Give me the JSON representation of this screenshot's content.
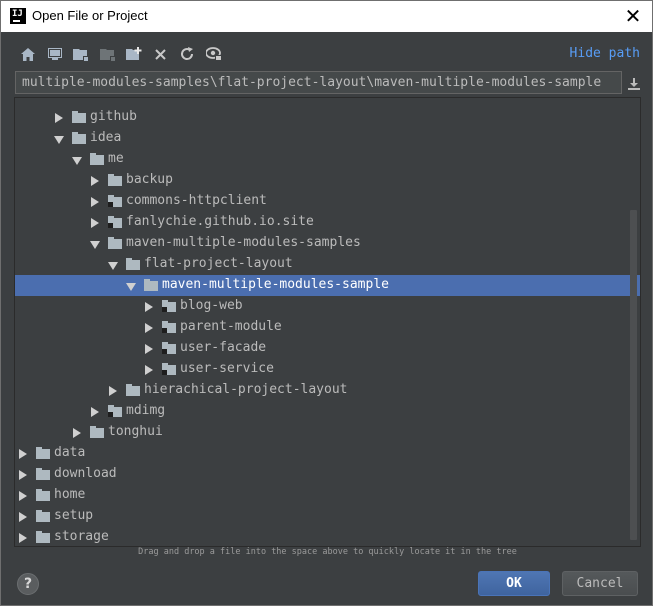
{
  "window": {
    "title": "Open File or Project"
  },
  "toolbar": {
    "buttons": [
      {
        "name": "home-icon"
      },
      {
        "name": "desktop-icon"
      },
      {
        "name": "project-folder-icon"
      },
      {
        "name": "module-folder-icon"
      },
      {
        "name": "new-folder-icon"
      },
      {
        "name": "delete-icon"
      },
      {
        "name": "refresh-icon"
      },
      {
        "name": "show-hidden-icon"
      }
    ],
    "hide_path": "Hide path"
  },
  "path": {
    "value": "multiple-modules-samples\\flat-project-layout\\maven-multiple-modules-sample"
  },
  "tree": {
    "rows": [
      {
        "label": "github",
        "depth": 3,
        "expanded": false,
        "badge": false,
        "selected": false
      },
      {
        "label": "idea",
        "depth": 3,
        "expanded": true,
        "badge": false,
        "selected": false
      },
      {
        "label": "me",
        "depth": 4,
        "expanded": true,
        "badge": false,
        "selected": false
      },
      {
        "label": "backup",
        "depth": 5,
        "expanded": false,
        "badge": false,
        "selected": false
      },
      {
        "label": "commons-httpclient",
        "depth": 5,
        "expanded": false,
        "badge": true,
        "selected": false
      },
      {
        "label": "fanlychie.github.io.site",
        "depth": 5,
        "expanded": false,
        "badge": true,
        "selected": false
      },
      {
        "label": "maven-multiple-modules-samples",
        "depth": 5,
        "expanded": true,
        "badge": false,
        "selected": false
      },
      {
        "label": "flat-project-layout",
        "depth": 6,
        "expanded": true,
        "badge": false,
        "selected": false
      },
      {
        "label": "maven-multiple-modules-sample",
        "depth": 7,
        "expanded": true,
        "badge": false,
        "selected": true
      },
      {
        "label": "blog-web",
        "depth": 8,
        "expanded": false,
        "badge": true,
        "selected": false
      },
      {
        "label": "parent-module",
        "depth": 8,
        "expanded": false,
        "badge": true,
        "selected": false
      },
      {
        "label": "user-facade",
        "depth": 8,
        "expanded": false,
        "badge": true,
        "selected": false
      },
      {
        "label": "user-service",
        "depth": 8,
        "expanded": false,
        "badge": true,
        "selected": false
      },
      {
        "label": "hierachical-project-layout",
        "depth": 6,
        "expanded": false,
        "badge": false,
        "selected": false
      },
      {
        "label": "mdimg",
        "depth": 5,
        "expanded": false,
        "badge": true,
        "selected": false
      },
      {
        "label": "tonghui",
        "depth": 4,
        "expanded": false,
        "badge": false,
        "selected": false
      },
      {
        "label": "data",
        "depth": 1,
        "expanded": false,
        "badge": false,
        "selected": false
      },
      {
        "label": "download",
        "depth": 1,
        "expanded": false,
        "badge": false,
        "selected": false
      },
      {
        "label": "home",
        "depth": 1,
        "expanded": false,
        "badge": false,
        "selected": false
      },
      {
        "label": "setup",
        "depth": 1,
        "expanded": false,
        "badge": false,
        "selected": false
      },
      {
        "label": "storage",
        "depth": 1,
        "expanded": false,
        "badge": false,
        "selected": false
      }
    ]
  },
  "hint": "Drag and drop a file into the space above to quickly locate it in the tree",
  "buttons": {
    "ok": "OK",
    "cancel": "Cancel",
    "help": "?"
  },
  "colors": {
    "background": "#3c3f41",
    "selection": "#4b6eaf",
    "link": "#589df6",
    "text": "#bbbbbb"
  }
}
